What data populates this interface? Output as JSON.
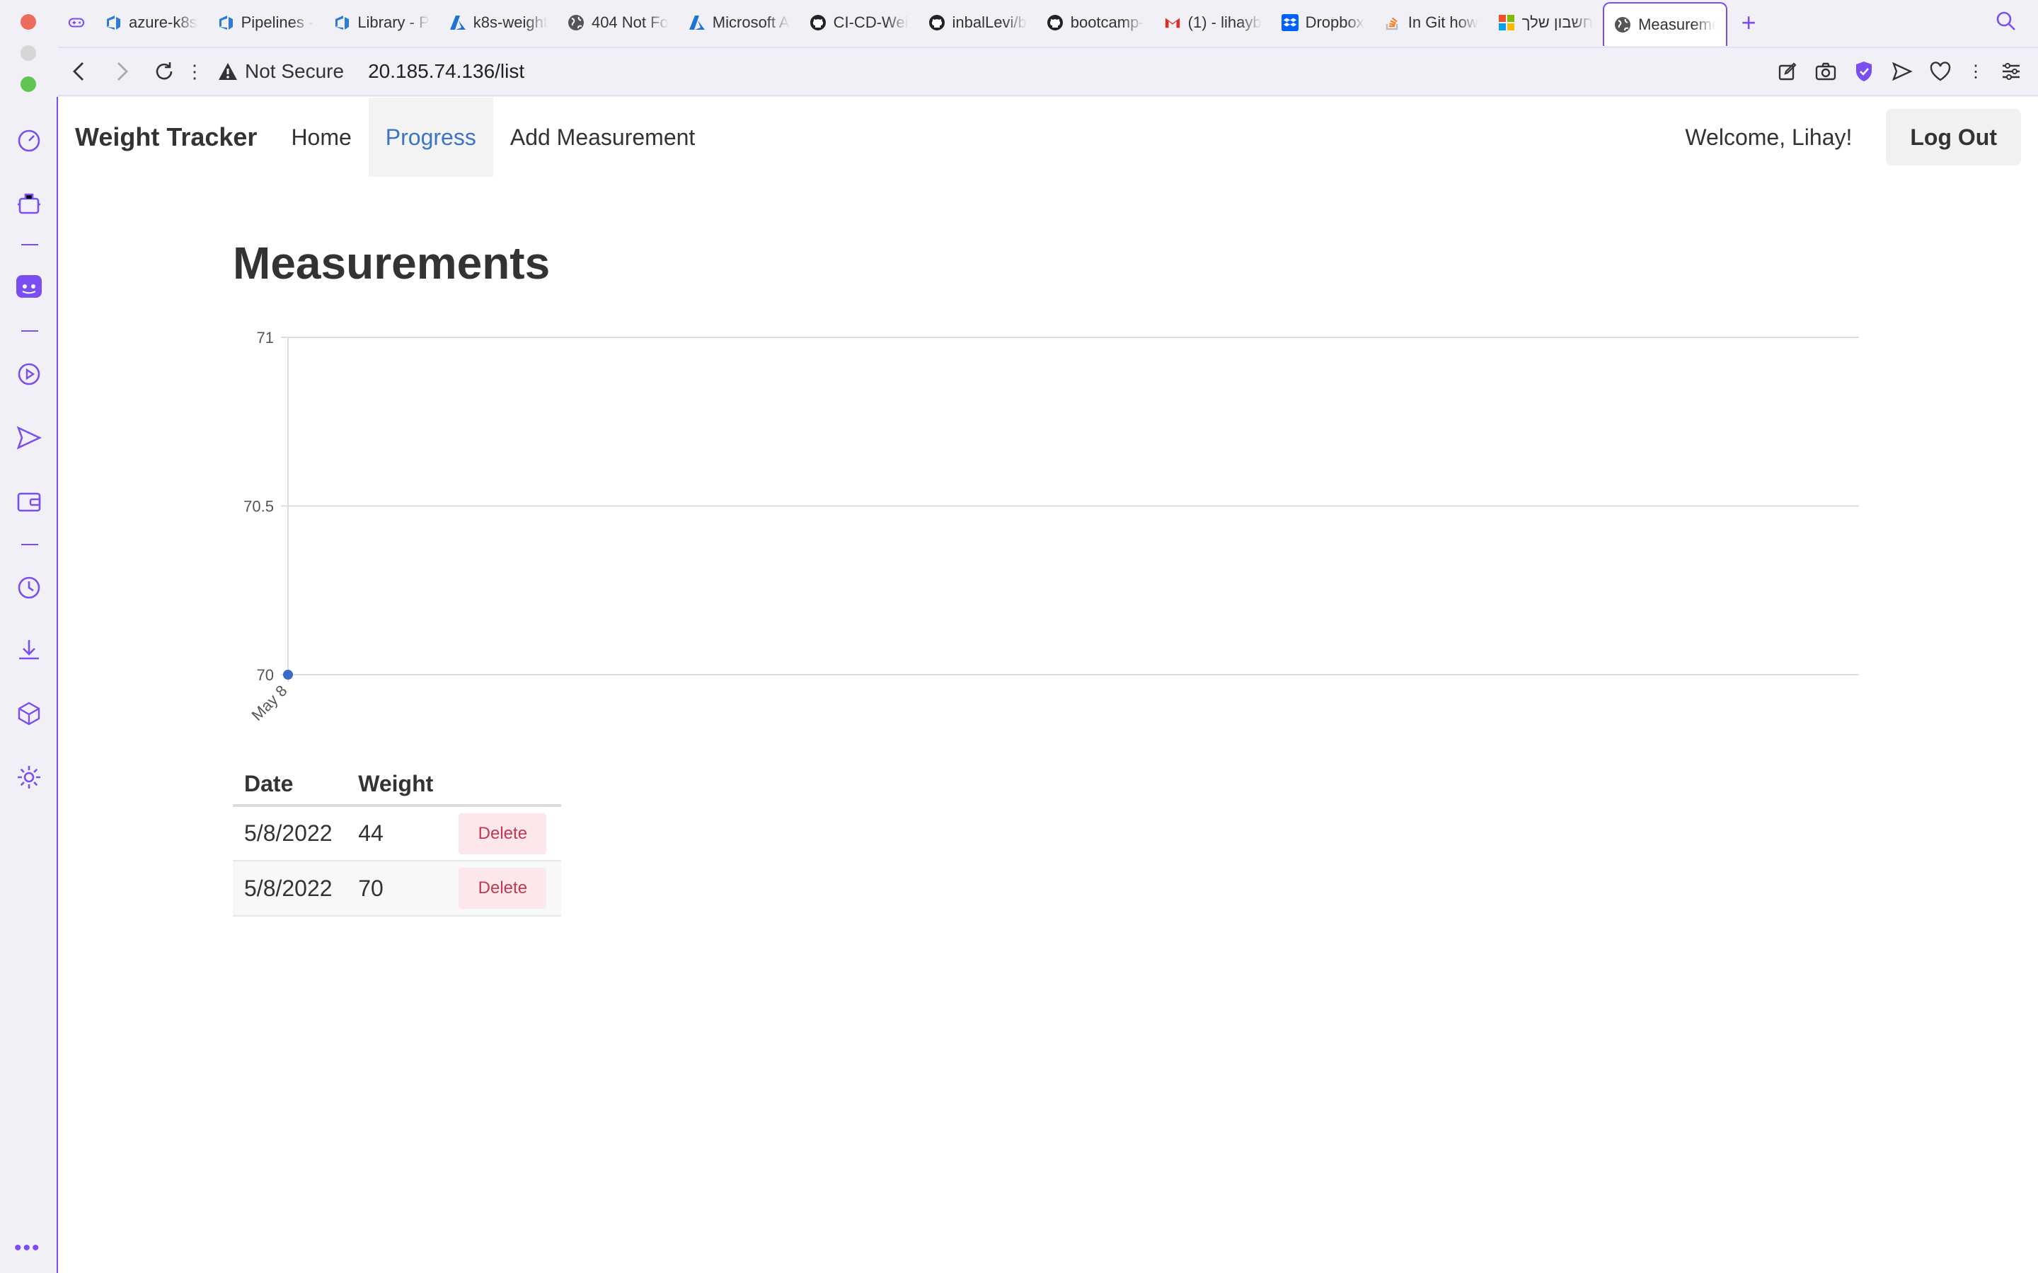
{
  "browser": {
    "tabs": [
      {
        "title": "",
        "icon": "game-controller-icon"
      },
      {
        "title": "azure-k8s",
        "icon": "azure-devops-icon"
      },
      {
        "title": "Pipelines -",
        "icon": "azure-devops-icon"
      },
      {
        "title": "Library - P",
        "icon": "azure-devops-icon"
      },
      {
        "title": "k8s-weight",
        "icon": "azure-icon"
      },
      {
        "title": "404 Not Fo",
        "icon": "globe-icon"
      },
      {
        "title": "Microsoft A",
        "icon": "azure-icon"
      },
      {
        "title": "CI-CD-Wei",
        "icon": "github-icon"
      },
      {
        "title": "inbalLevi/b",
        "icon": "github-icon"
      },
      {
        "title": "bootcamp-",
        "icon": "github-icon"
      },
      {
        "title": "(1) - lihayb",
        "icon": "gmail-icon"
      },
      {
        "title": "Dropbox",
        "icon": "dropbox-icon"
      },
      {
        "title": "In Git how",
        "icon": "stackoverflow-icon"
      },
      {
        "title": "חשבון שלך",
        "icon": "microsoft-icon"
      },
      {
        "title": "Measureme",
        "icon": "globe-icon",
        "active": true
      }
    ],
    "security_label": "Not Secure",
    "url": "20.185.74.136/list",
    "accent": "#7a4ef0"
  },
  "navbar": {
    "brand": "Weight Tracker",
    "links": [
      "Home",
      "Progress",
      "Add Measurement"
    ],
    "active_link": "Progress",
    "welcome": "Welcome, Lihay!",
    "logout_label": "Log Out"
  },
  "main": {
    "title": "Measurements",
    "table": {
      "headers": [
        "Date",
        "Weight",
        ""
      ],
      "rows": [
        {
          "date": "5/8/2022",
          "weight": "44",
          "action": "Delete"
        },
        {
          "date": "5/8/2022",
          "weight": "70",
          "action": "Delete"
        }
      ]
    }
  },
  "chart_data": {
    "type": "line",
    "x": [
      "May 8"
    ],
    "series": [
      {
        "values": [
          70
        ]
      }
    ],
    "y_ticks": [
      "70",
      "70.5",
      "71"
    ],
    "ylim": [
      70,
      71
    ],
    "grid": true,
    "title": "",
    "xlabel": "",
    "ylabel": "",
    "color": "#3a6bc4"
  }
}
